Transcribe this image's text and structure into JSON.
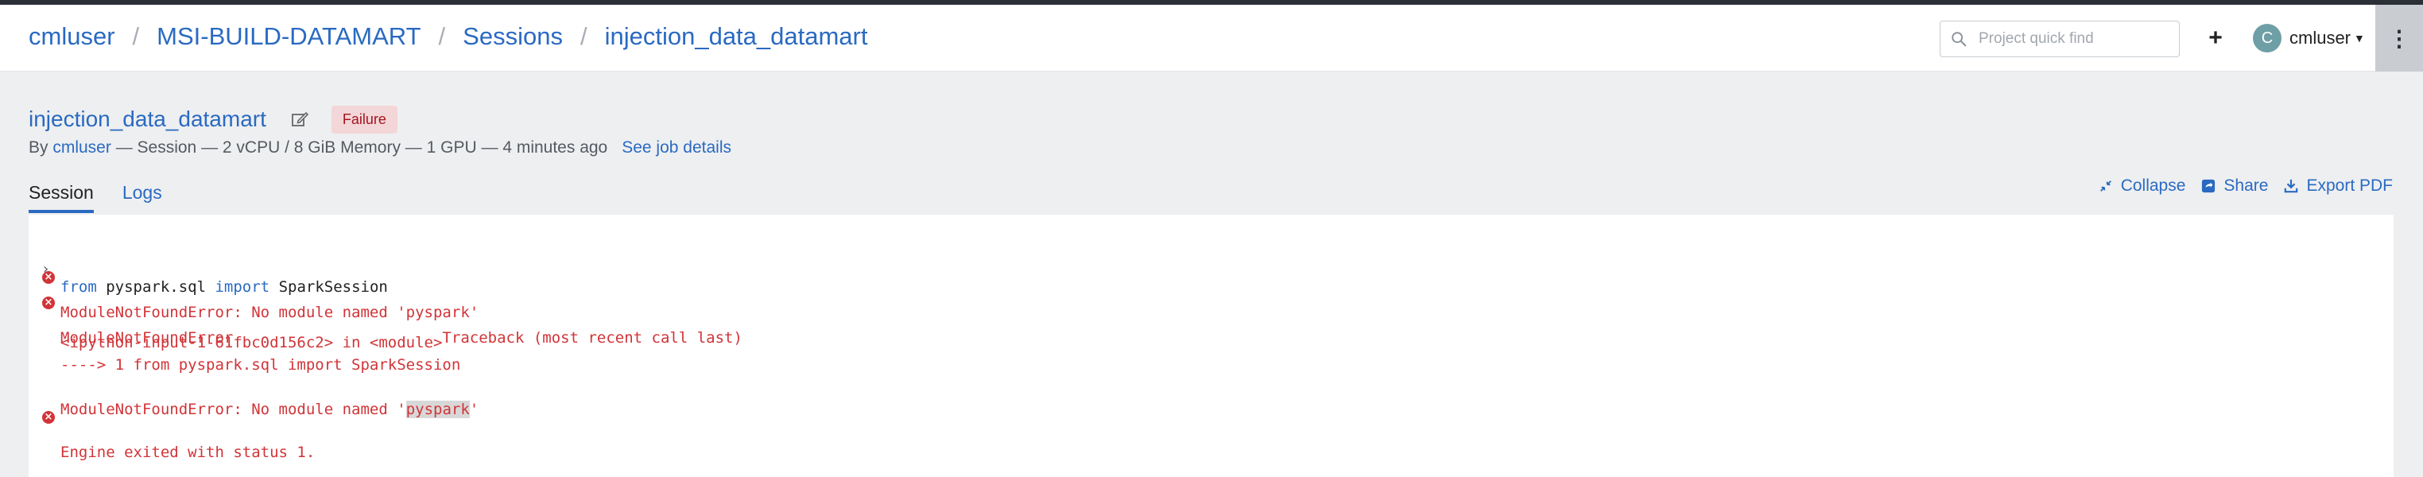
{
  "breadcrumb": {
    "items": [
      "cmluser",
      "MSI-BUILD-DATAMART",
      "Sessions",
      "injection_data_datamart"
    ],
    "separator": "/"
  },
  "search": {
    "placeholder": "Project quick find"
  },
  "header": {
    "add_icon": "plus-icon",
    "user": {
      "initial": "C",
      "name": "cmluser"
    },
    "menu_icon": "kebab-icon"
  },
  "session": {
    "title": "injection_data_datamart",
    "status": "Failure",
    "meta": {
      "by": "By ",
      "user": "cmluser",
      "details": " — Session — 2 vCPU / 8 GiB Memory — 1 GPU — 4 minutes ago",
      "job_link": "See job details"
    }
  },
  "tabs": [
    {
      "label": "Session",
      "active": true
    },
    {
      "label": "Logs",
      "active": false
    }
  ],
  "actions": {
    "collapse": "Collapse",
    "share": "Share",
    "export": "Export PDF"
  },
  "console": {
    "input": {
      "kw1": "from",
      "mod": " pyspark.sql ",
      "kw2": "import",
      "name": " SparkSession"
    },
    "error1": "ModuleNotFoundError: No module named 'pyspark'",
    "traceback_header": "ModuleNotFoundError                       Traceback (most recent call last)",
    "traceback_line1": "<ipython-input-1-61fbc0d156c2> in <module>",
    "traceback_line2": "----> 1 from pyspark.sql import SparkSession",
    "traceback_final_pre": "ModuleNotFoundError: No module named '",
    "traceback_final_hl": "pyspark",
    "traceback_final_post": "'",
    "exit": "Engine exited with status 1."
  },
  "colors": {
    "link": "#2a6ac1",
    "error": "#d13438",
    "failure_badge_bg": "#f3d6d8",
    "failure_badge_text": "#a31521"
  }
}
